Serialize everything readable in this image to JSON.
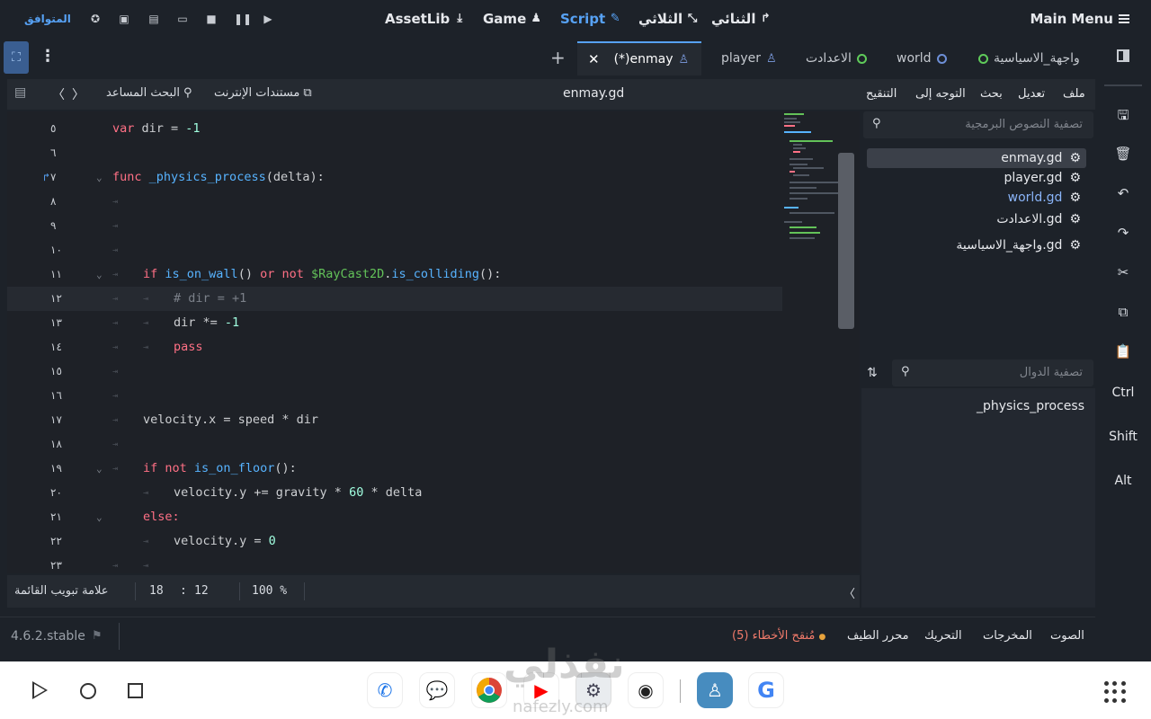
{
  "topbar": {
    "main_menu": "Main Menu",
    "workspaces": [
      {
        "label": "الثنائي",
        "icon": "2d-icon"
      },
      {
        "label": "الثلاثي",
        "icon": "3d-icon"
      },
      {
        "label": "Script",
        "icon": "script-icon",
        "active": true
      },
      {
        "label": "Game",
        "icon": "game-icon"
      },
      {
        "label": "AssetLib",
        "icon": "assetlib-icon"
      }
    ],
    "renderer": "المتوافق",
    "run_buttons": [
      "play-icon",
      "pause-icon",
      "stop-icon",
      "remote-debug-icon",
      "play-scene-icon",
      "play-custom-icon",
      "movie-icon"
    ]
  },
  "tabs": [
    {
      "label": "واجهة_الاسياسية",
      "icon": "scene-ring-icon"
    },
    {
      "label": "world",
      "icon": "scene-ring-icon"
    },
    {
      "label": "الاعدادت",
      "icon": "scene-ring-icon"
    },
    {
      "label": "player",
      "icon": "node-icon"
    },
    {
      "label": "(*)enmay",
      "icon": "node-icon",
      "active": true
    }
  ],
  "editor_menu": {
    "items": [
      "ملف",
      "تعديل",
      "بحث",
      "التوجه إلى",
      "التنقيح"
    ],
    "script_name": "enmay.gd",
    "online_docs": "مستندات الإنترنت",
    "search_help": "البحث المساعد"
  },
  "code": {
    "current_line": "١٢",
    "lines": [
      {
        "num": "٥",
        "text": "var dir = -1"
      },
      {
        "num": "٦",
        "text": ""
      },
      {
        "num": "٧",
        "text": "func _physics_process(delta):"
      },
      {
        "num": "٨",
        "text": ""
      },
      {
        "num": "٩",
        "text": ""
      },
      {
        "num": "١٠",
        "text": ""
      },
      {
        "num": "١١",
        "text": "if is_on_wall() or not $RayCast2D.is_colliding():"
      },
      {
        "num": "١٢",
        "text": "# dir = +1"
      },
      {
        "num": "١٣",
        "text": "dir *= -1"
      },
      {
        "num": "١٤",
        "text": "pass"
      },
      {
        "num": "١٥",
        "text": ""
      },
      {
        "num": "١٦",
        "text": ""
      },
      {
        "num": "١٧",
        "text": "velocity.x = speed * dir"
      },
      {
        "num": "١٨",
        "text": ""
      },
      {
        "num": "١٩",
        "text": "if not is_on_floor():"
      },
      {
        "num": "٢٠",
        "text": "velocity.y += gravity * 60 * delta"
      },
      {
        "num": "٢١",
        "text": "else:"
      },
      {
        "num": "٢٢",
        "text": "velocity.y = 0"
      },
      {
        "num": "٢٣",
        "text": ""
      }
    ]
  },
  "statusbar": {
    "list_tab": "علامة تبويب القائمة",
    "line": "18",
    "colon": ":",
    "column": "12",
    "zoom": "100 %"
  },
  "sidepanel": {
    "script_filter_placeholder": "تصفية النصوص البرمجية",
    "scripts": [
      "enmay.gd",
      "player.gd",
      "world.gd",
      "الاعدادت.gd",
      "واجهة_الاسياسية.gd"
    ],
    "method_filter_placeholder": "تصفية الدوال",
    "methods": [
      "_physics_process"
    ]
  },
  "right_toolbar": {
    "keys": [
      "Ctrl",
      "Shift",
      "Alt"
    ]
  },
  "bottombar": {
    "version": "4.6.2.stable",
    "tabs": [
      "الصوت",
      "المخرجات",
      "التحريك",
      "محرر الطيف",
      "مُنقح الأخطاء (5)"
    ]
  },
  "watermark": {
    "text": "نفذلي",
    "sub": "nafezly.com"
  },
  "colors": {
    "accent": "#57a2f5",
    "keyword": "#ff7085",
    "function": "#57b3ff",
    "number": "#a1ffe0",
    "node_path": "#63c259",
    "error": "#f07a6a"
  }
}
